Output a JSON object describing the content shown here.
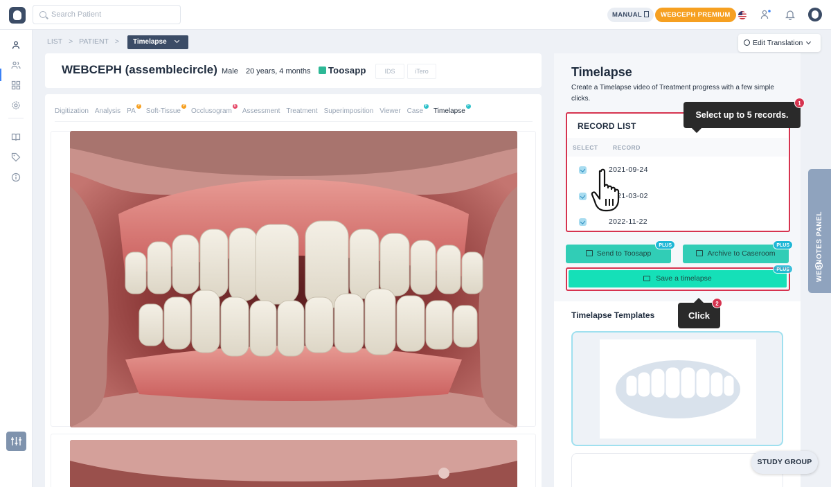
{
  "topbar": {
    "search_placeholder": "Search Patient",
    "manual_label": "MANUAL",
    "premium_label": "WEBCEPH PREMIUM",
    "icons": [
      "search-icon",
      "doc-icon",
      "us-flag-icon",
      "users-icon",
      "bell-icon",
      "avatar"
    ]
  },
  "breadcrumb": {
    "list": "LIST",
    "separator": ">",
    "patient": "PATIENT",
    "current": "Timelapse"
  },
  "patient": {
    "name": "WEBCEPH (assemblecircle)",
    "sex": "Male",
    "age": "20 years, 4 months",
    "toosapp": "Toosapp",
    "ids": "IDS",
    "itero": "iTero"
  },
  "tabs": [
    {
      "label": "Digitization",
      "badge": ""
    },
    {
      "label": "Analysis",
      "badge": ""
    },
    {
      "label": "PA",
      "badge": "P"
    },
    {
      "label": "Soft-Tissue",
      "badge": "P"
    },
    {
      "label": "Occlusogram",
      "badge": "E"
    },
    {
      "label": "Assessment",
      "badge": ""
    },
    {
      "label": "Treatment",
      "badge": ""
    },
    {
      "label": "Superimposition",
      "badge": ""
    },
    {
      "label": "Viewer",
      "badge": ""
    },
    {
      "label": "Case",
      "badge": "P"
    },
    {
      "label": "Timelapse",
      "badge": "P"
    }
  ],
  "timelapse": {
    "title": "Timelapse",
    "description": "Create a Timelapse video of Treatment progress with a few simple clicks.",
    "record_list_title": "RECORD LIST",
    "col_select": "SELECT",
    "col_record": "RECORD",
    "records": [
      "2021-09-24",
      "2021-03-02",
      "2022-11-22"
    ],
    "send_label": "Send to Toosapp",
    "archive_label": "Archive to Caseroom",
    "save_label": "Save a timelapse",
    "plus_tag": "PLUS",
    "templates_title": "Timelapse Templates"
  },
  "tooltips": {
    "step1_text": "Select up to 5 records.",
    "step1_num": "1",
    "step2_text": "Click",
    "step2_num": "2"
  },
  "edit_translation": "Edit Translation",
  "webnotes_label": "WEBNOTES PANEL",
  "study_group": "STUDY GROUP",
  "colors": {
    "accent_teal": "#31cdb6",
    "highlight_red": "#d6334f",
    "premium_orange": "#f6a021",
    "navy": "#3b4c66"
  }
}
